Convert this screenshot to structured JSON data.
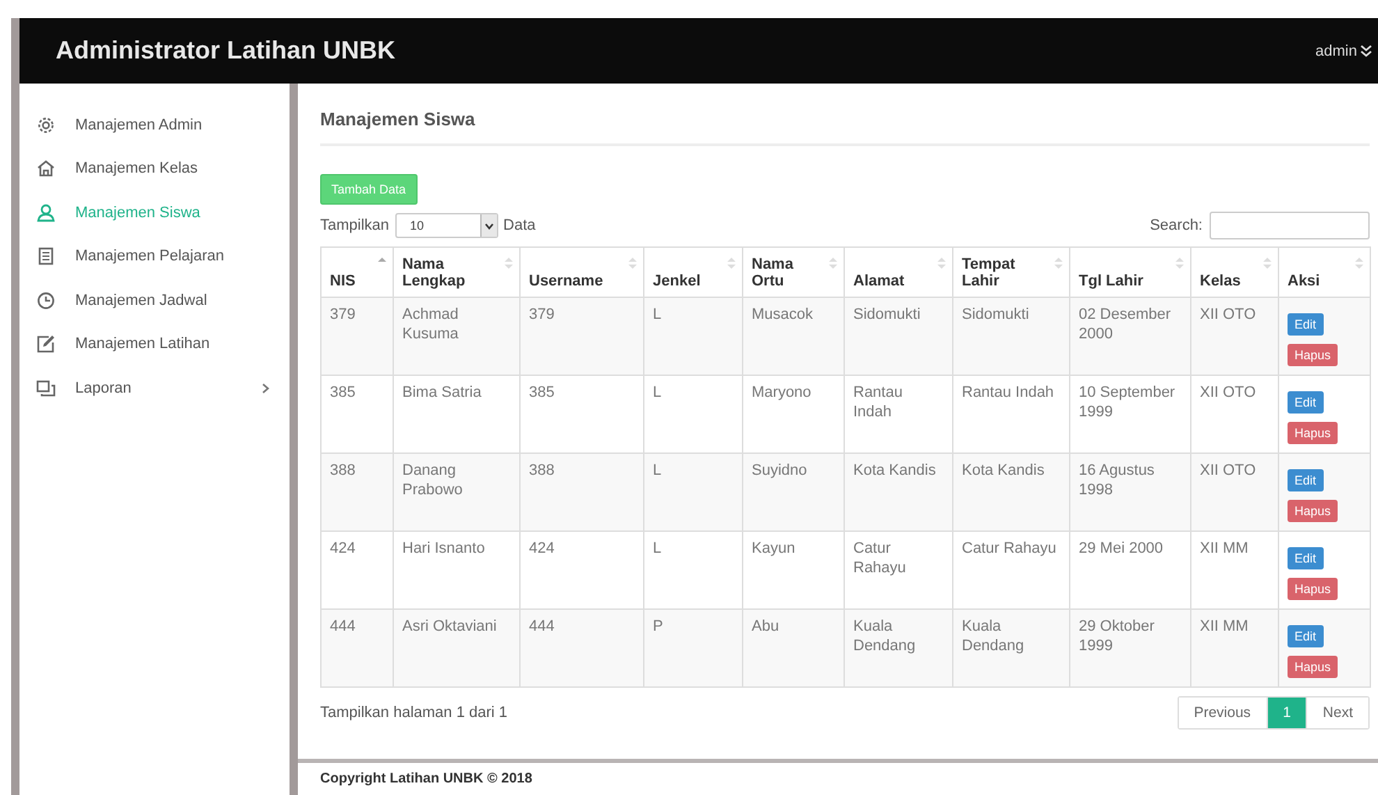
{
  "header": {
    "title": "Administrator Latihan UNBK",
    "user": "admin"
  },
  "sidebar": {
    "items": [
      {
        "label": "Manajemen Admin",
        "selected": false,
        "expandable": false
      },
      {
        "label": "Manajemen Kelas",
        "selected": false,
        "expandable": false
      },
      {
        "label": "Manajemen Siswa",
        "selected": true,
        "expandable": false
      },
      {
        "label": "Manajemen Pelajaran",
        "selected": false,
        "expandable": false
      },
      {
        "label": "Manajemen Jadwal",
        "selected": false,
        "expandable": false
      },
      {
        "label": "Manajemen Latihan",
        "selected": false,
        "expandable": false
      },
      {
        "label": "Laporan",
        "selected": false,
        "expandable": true
      }
    ]
  },
  "content": {
    "title": "Manajemen Siswa",
    "add_button": "Tambah Data",
    "length": {
      "prefix": "Tampilkan",
      "value": "10",
      "suffix": "Data"
    },
    "search": {
      "label": "Search:"
    },
    "table": {
      "columns": [
        {
          "label": "NIS",
          "sorted": true
        },
        {
          "label": "Nama Lengkap",
          "sorted": false
        },
        {
          "label": "Username",
          "sorted": false
        },
        {
          "label": "Jenkel",
          "sorted": false
        },
        {
          "label": "Nama Ortu",
          "sorted": false
        },
        {
          "label": "Alamat",
          "sorted": false
        },
        {
          "label": "Tempat Lahir",
          "sorted": false
        },
        {
          "label": "Tgl Lahir",
          "sorted": false
        },
        {
          "label": "Kelas",
          "sorted": false
        },
        {
          "label": "Aksi",
          "sorted": false
        }
      ],
      "rows": [
        {
          "cells": [
            "379",
            "Achmad Kusuma",
            "379",
            "L",
            "Musacok",
            "Sidomukti",
            "Sidomukti",
            "02 Desember 2000",
            "XII OTO"
          ],
          "actions": [
            "Edit",
            "Hapus"
          ]
        },
        {
          "cells": [
            "385",
            "Bima Satria",
            "385",
            "L",
            "Maryono",
            "Rantau Indah",
            "Rantau Indah",
            "10 September 1999",
            "XII OTO"
          ],
          "actions": [
            "Edit",
            "Hapus"
          ]
        },
        {
          "cells": [
            "388",
            "Danang Prabowo",
            "388",
            "L",
            "Suyidno",
            "Kota Kandis",
            "Kota Kandis",
            "16 Agustus 1998",
            "XII OTO"
          ],
          "actions": [
            "Edit",
            "Hapus"
          ]
        },
        {
          "cells": [
            "424",
            "Hari Isnanto",
            "424",
            "L",
            "Kayun",
            "Catur Rahayu",
            "Catur Rahayu",
            "29 Mei 2000",
            "XII MM"
          ],
          "actions": [
            "Edit",
            "Hapus"
          ]
        },
        {
          "cells": [
            "444",
            "Asri Oktaviani",
            "444",
            "P",
            "Abu",
            "Kuala Dendang",
            "Kuala Dendang",
            "29 Oktober 1999",
            "XII MM"
          ],
          "actions": [
            "Edit",
            "Hapus"
          ]
        }
      ]
    },
    "info": "Tampilkan halaman 1 dari 1",
    "pagination": [
      {
        "label": "Previous",
        "selected": false
      },
      {
        "label": "1",
        "selected": true
      },
      {
        "label": "Next",
        "selected": false
      }
    ]
  },
  "footer": "Copyright Latihan UNBK © 2018"
}
